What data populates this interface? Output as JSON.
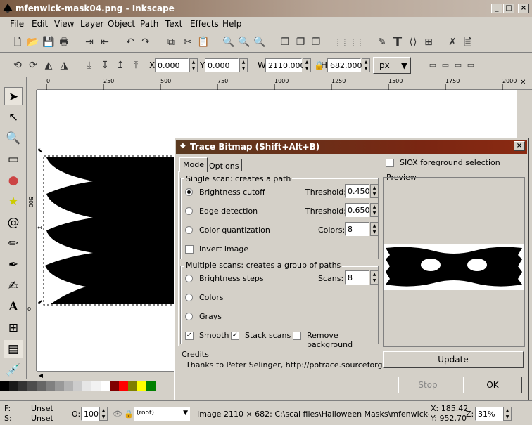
{
  "window": {
    "title": "mfenwick-mask04.png - Inkscape"
  },
  "menu": [
    "File",
    "Edit",
    "View",
    "Layer",
    "Object",
    "Path",
    "Text",
    "Effects",
    "Help"
  ],
  "toolbar2": {
    "x_label": "X",
    "x_value": "0.000",
    "y_label": "Y",
    "y_value": "0.000",
    "w_label": "W",
    "w_value": "2110.000",
    "h_label": "H",
    "h_value": "682.000",
    "unit": "px"
  },
  "ruler": {
    "h_ticks": [
      "0",
      "250",
      "500",
      "750",
      "1000",
      "1250",
      "1500",
      "1750",
      "2000"
    ],
    "v_ticks": [
      "500",
      "0"
    ]
  },
  "dialog": {
    "title": "Trace Bitmap (Shift+Alt+B)",
    "tabs": [
      "Mode",
      "Options"
    ],
    "single_scan": {
      "label": "Single scan: creates a path",
      "brightness": "Brightness cutoff",
      "threshold_label": "Threshold:",
      "brightness_threshold": "0.450",
      "edge": "Edge detection",
      "edge_threshold": "0.650",
      "color_q": "Color quantization",
      "colors_label": "Colors:",
      "colors_value": "8",
      "invert": "Invert image"
    },
    "multi_scan": {
      "label": "Multiple scans: creates a group of paths",
      "bsteps": "Brightness steps",
      "scans_label": "Scans:",
      "scans_value": "8",
      "colors": "Colors",
      "grays": "Grays",
      "smooth": "Smooth",
      "stack": "Stack scans",
      "remove_bg": "Remove background"
    },
    "credits": {
      "label": "Credits",
      "text": "Thanks to Peter Selinger, http://potrace.sourceforge.net"
    },
    "siox": "SIOX foreground selection",
    "preview": "Preview",
    "update": "Update",
    "stop": "Stop",
    "ok": "OK"
  },
  "status": {
    "fill_label": "F:",
    "fill_value": "Unset",
    "stroke_label": "S:",
    "stroke_value": "Unset",
    "opacity_label": "O:",
    "opacity_value": "100",
    "layer": "(root)",
    "message": "Image 2110 × 682: C:\\scal files\\Halloween Masks\\mfenwick-mask04.",
    "x_coord": "X: 185.42",
    "y_coord": "Y: 952.70",
    "zoom_label": "Z:",
    "zoom": "31%"
  },
  "palette_colors": [
    "#000000",
    "#1a1a1a",
    "#333333",
    "#4d4d4d",
    "#666666",
    "#808080",
    "#999999",
    "#b3b3b3",
    "#cccccc",
    "#e6e6e6",
    "#f2f2f2",
    "#ffffff",
    "#800000",
    "#ff0000",
    "#808000",
    "#ffff00",
    "#008000"
  ]
}
